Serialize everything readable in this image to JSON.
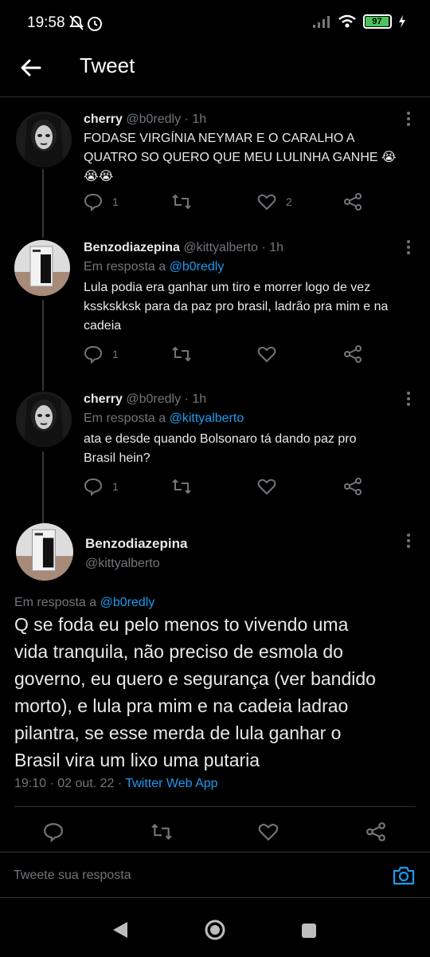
{
  "status": {
    "time": "19:58",
    "battery": "97"
  },
  "header": {
    "title": "Tweet"
  },
  "tweets": [
    {
      "name": "cherry",
      "handle": "@b0redly",
      "age": "· 1h",
      "text_lines": [
        "FODASE VIRGÍNIA NEYMAR E O CARALHO A",
        "QUATRO SO QUERO QUE MEU LULINHA GANHE 😭",
        "😭😭"
      ],
      "replies": "1",
      "likes": "2"
    },
    {
      "name": "Benzodiazepina",
      "handle": "@kittyalberto",
      "age": "· 1h",
      "reply_prefix": "Em resposta a",
      "reply_to": "@b0redly",
      "text_lines": [
        "Lula podia era ganhar um tiro e morrer logo de vez",
        "ksskskksk para da paz pro brasil, ladrão pra mim e na",
        "cadeia"
      ],
      "replies": "1"
    },
    {
      "name": "cherry",
      "handle": "@b0redly",
      "age": "· 1h",
      "reply_prefix": "Em resposta a",
      "reply_to": "@kittyalberto",
      "text_lines": [
        "ata e desde quando Bolsonaro tá dando paz pro",
        "Brasil hein?"
      ],
      "replies": "1"
    }
  ],
  "main_tweet": {
    "name": "Benzodiazepina",
    "handle": "@kittyalberto",
    "reply_prefix": "Em resposta a",
    "reply_to": "@b0redly",
    "text_lines": [
      "Q se foda eu pelo menos to vivendo uma",
      "vida tranquila, não preciso de esmola do",
      "governo, eu quero e segurança (ver bandido",
      "morto), e lula pra mim e na cadeia ladrao",
      "pilantra, se esse merda de lula ganhar o",
      "Brasil vira um lixo uma putaria"
    ],
    "timestamp": "19:10 · 02 out. 22 ·",
    "source": "Twitter Web App"
  },
  "reply_bar": {
    "placeholder": "Tweete sua resposta"
  }
}
